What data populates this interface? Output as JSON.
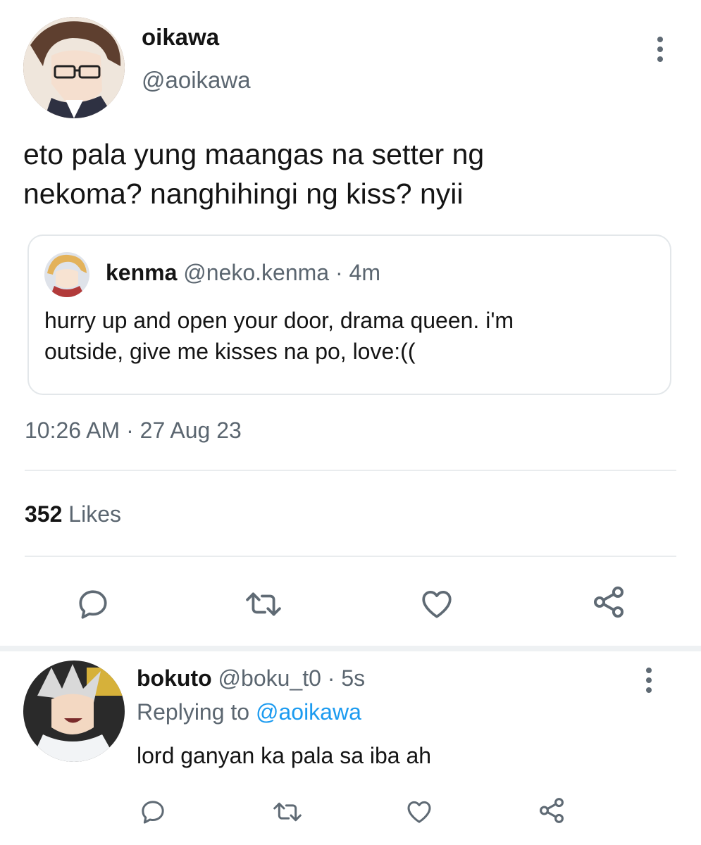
{
  "main_tweet": {
    "display_name": "oikawa",
    "handle": "@aoikawa",
    "text_line1": "eto pala yung maangas na setter ng",
    "text_line2": "nekoma? nanghihingi ng kiss? nyii",
    "quoted": {
      "display_name": "kenma",
      "handle": "@neko.kenma",
      "separator": "·",
      "time": "4m",
      "text_line1": "hurry up and open your door, drama queen. i'm",
      "text_line2": "outside, give me kisses na po, love:(("
    },
    "timestamp": "10:26 AM · 27 Aug 23",
    "likes_count": "352",
    "likes_label": "Likes",
    "icons": {
      "more": "more-vertical-icon",
      "reply": "reply-icon",
      "retweet": "retweet-icon",
      "like": "heart-icon",
      "share": "share-icon"
    }
  },
  "reply": {
    "display_name": "bokuto",
    "handle": "@boku_t0",
    "separator": "·",
    "time": "5s",
    "replying_prefix": "Replying to",
    "replying_handle": "@aoikawa",
    "text": "lord ganyan ka pala sa iba ah"
  },
  "colors": {
    "link": "#1c9bf0",
    "muted": "#5b6670",
    "divider": "#e9ecee",
    "text": "#141414"
  }
}
